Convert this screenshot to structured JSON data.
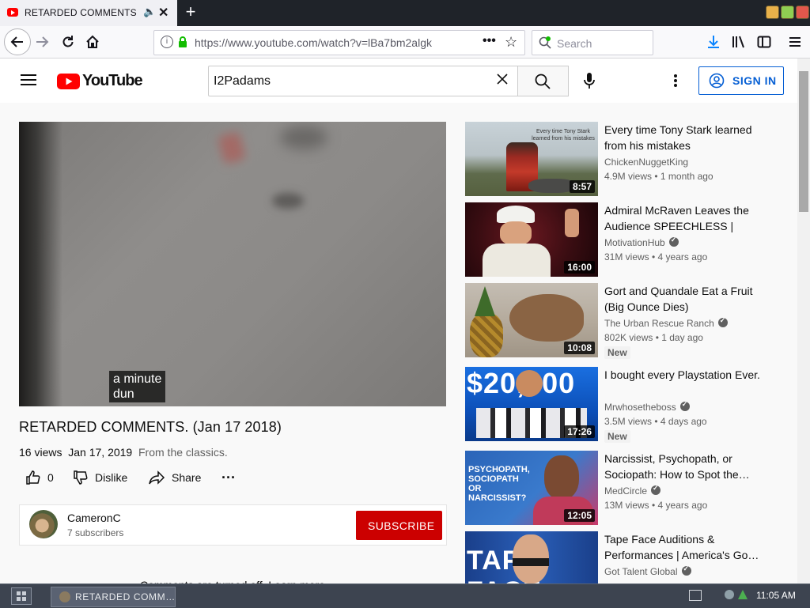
{
  "browser": {
    "tab_title": "RETARDED COMMENTS. (",
    "url": "https://www.youtube.com/watch?v=lBa7bm2algk",
    "search_placeholder": "Search"
  },
  "youtube": {
    "logo_text": "YouTube",
    "search_query": "I2Padams",
    "sign_in_label": "SIGN IN"
  },
  "video": {
    "caption": "a minute\ndun",
    "title": "RETARDED COMMENTS. (Jan 17 2018)",
    "views": "16 views",
    "date": "Jan 17, 2019",
    "description": "From the classics.",
    "likes": "0",
    "dislike_label": "Dislike",
    "share_label": "Share"
  },
  "channel": {
    "name": "CameronC",
    "subscribers": "7 subscribers",
    "subscribe_label": "SUBSCRIBE"
  },
  "comments_notice": "Comments are turned off. Learn more",
  "recommendations": [
    {
      "title": "Every time Tony Stark learned from his mistakes",
      "channel": "ChickenNuggetKing",
      "verified": false,
      "meta": "4.9M views • 1 month ago",
      "duration": "8:57",
      "thumb_text": "Every time Tony Stark learned from his mistakes",
      "badge": ""
    },
    {
      "title": "Admiral McRaven Leaves the Audience SPEECHLESS | One…",
      "channel": "MotivationHub",
      "verified": true,
      "meta": "31M views • 4 years ago",
      "duration": "16:00",
      "thumb_text": "",
      "badge": ""
    },
    {
      "title": "Gort and Quandale Eat a Fruit (Big Ounce Dies)",
      "channel": "The Urban Rescue Ranch",
      "verified": true,
      "meta": "802K views • 1 day ago",
      "duration": "10:08",
      "thumb_text": "",
      "badge": "New"
    },
    {
      "title": "I bought every Playstation Ever.",
      "channel": "Mrwhosetheboss",
      "verified": true,
      "meta": "3.5M views • 4 days ago",
      "duration": "17:26",
      "thumb_text": "$20,000",
      "badge": "New"
    },
    {
      "title": "Narcissist, Psychopath, or Sociopath: How to Spot the…",
      "channel": "MedCircle",
      "verified": true,
      "meta": "13M views • 4 years ago",
      "duration": "12:05",
      "thumb_text": "PSYCHOPATH, SOCIOPATH OR NARCISSIST?",
      "badge": ""
    },
    {
      "title": "Tape Face Auditions & Performances | America's Go…",
      "channel": "Got Talent Global",
      "verified": true,
      "meta": "",
      "duration": "",
      "thumb_text": "TAPE FACE",
      "badge": ""
    }
  ],
  "taskbar": {
    "window_label": "RETARDED COMM…",
    "clock": "11:05 AM"
  },
  "colors": {
    "youtube_red": "#ff0000",
    "subscribe_red": "#cc0000",
    "signin_blue": "#065fd4"
  }
}
